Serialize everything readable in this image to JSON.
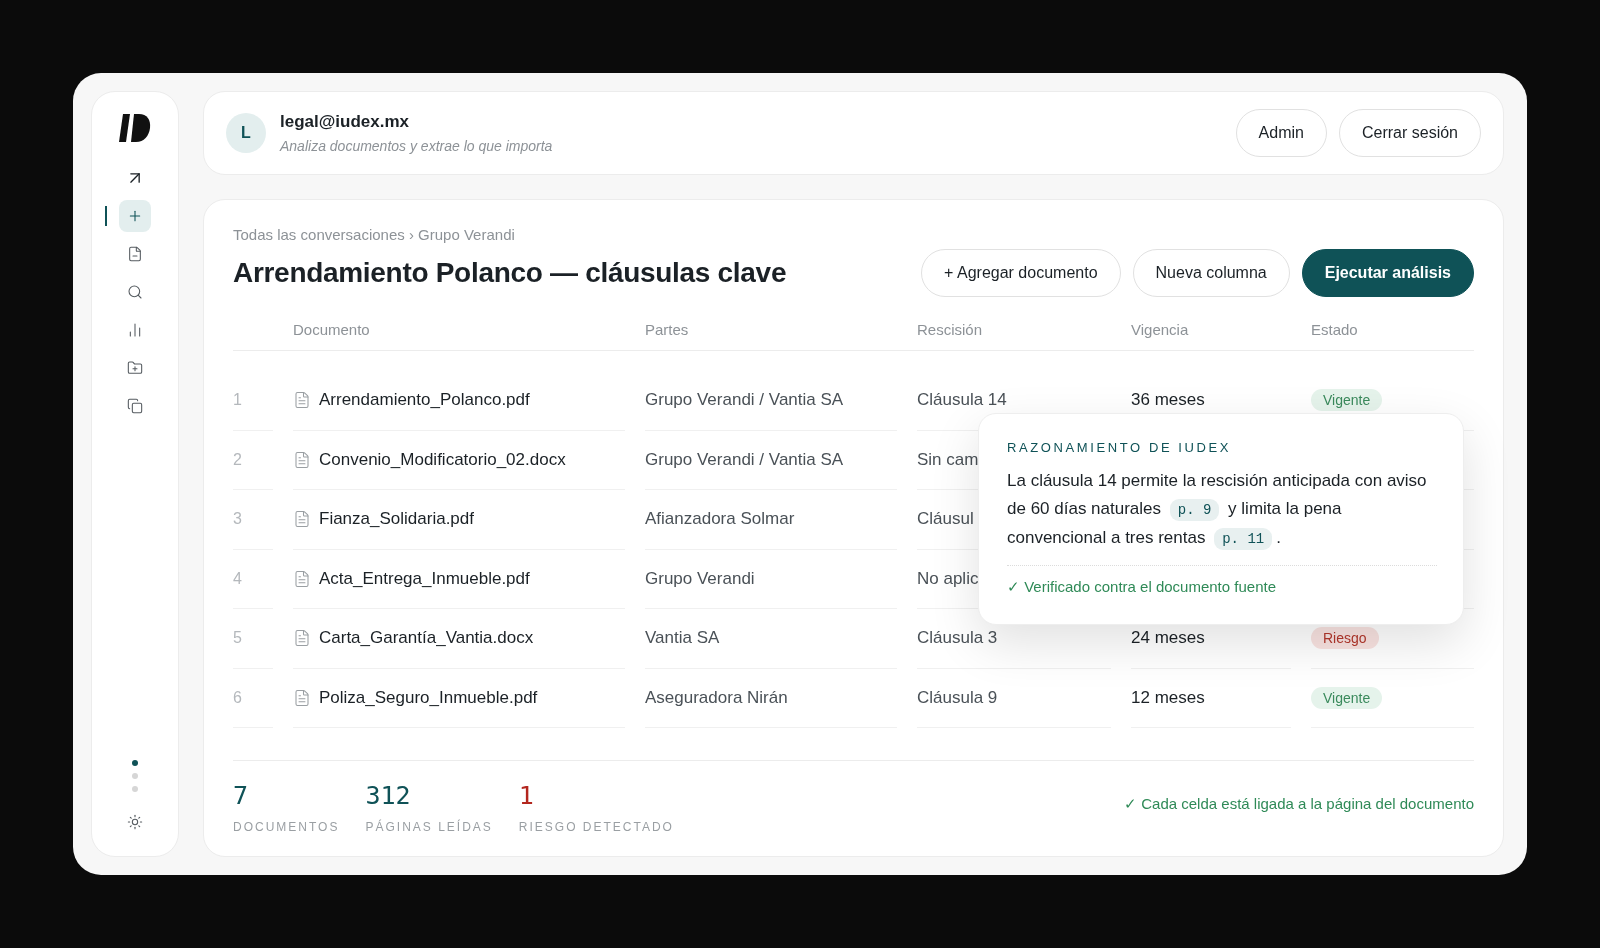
{
  "sidebar": {
    "items": [
      {
        "selected": false
      },
      {
        "selected": true
      },
      {
        "selected": false
      },
      {
        "selected": false
      },
      {
        "selected": false
      },
      {
        "selected": false
      },
      {
        "selected": false
      }
    ],
    "pager": [
      {
        "selected": true
      },
      {
        "selected": false
      },
      {
        "selected": false
      }
    ]
  },
  "header": {
    "avatar": "L",
    "email": "legal@iudex.mx",
    "tagline": "Analiza documentos y extrae lo que importa",
    "buttons": [
      "Admin",
      "Cerrar sesión"
    ]
  },
  "breadcrumb": "Todas las conversaciones › Grupo Verandi",
  "title": "Arrendamiento Polanco — cláusulas clave",
  "actions": [
    {
      "label": "+ Agregar documento",
      "kind": "outline"
    },
    {
      "label": "Nueva columna",
      "kind": "outline"
    },
    {
      "label": "Ejecutar análisis",
      "kind": "primary"
    }
  ],
  "table": {
    "columns": [
      "Documento",
      "Partes",
      "Rescisión",
      "Vigencia",
      "Estado"
    ],
    "rows": [
      {
        "num": "1",
        "document": "Arrendamiento_Polanco.pdf",
        "parties": "Grupo Verandi / Vantia SA",
        "rescission": "Cláusula 14",
        "term": "36 meses",
        "status": {
          "label": "Vigente",
          "kind": "ok"
        }
      },
      {
        "num": "2",
        "document": "Convenio_Modificatorio_02.docx",
        "parties": "Grupo Verandi / Vantia SA",
        "rescission": "Sin cam"
      },
      {
        "num": "3",
        "document": "Fianza_Solidaria.pdf",
        "parties": "Afianzadora Solmar",
        "rescission": "Cláusul"
      },
      {
        "num": "4",
        "document": "Acta_Entrega_Inmueble.pdf",
        "parties": "Grupo Verandi",
        "rescission": "No aplic"
      },
      {
        "num": "5",
        "document": "Carta_Garantía_Vantia.docx",
        "parties": "Vantia SA",
        "rescission": "Cláusula 3",
        "term": "24 meses",
        "status": {
          "label": "Riesgo",
          "kind": "risk"
        }
      },
      {
        "num": "6",
        "document": "Poliza_Seguro_Inmueble.pdf",
        "parties": "Aseguradora Nirán",
        "rescission": "Cláusula 9",
        "term": "12 meses",
        "status": {
          "label": "Vigente",
          "kind": "ok"
        }
      }
    ]
  },
  "popover": {
    "label": "RAZONAMIENTO DE IUDEX",
    "body": [
      {
        "kind": "text",
        "text": "La cláusula 14 permite la rescisión anticipada con aviso de 60 días naturales"
      },
      {
        "kind": "ref",
        "text": "p. 9"
      },
      {
        "kind": "text",
        "text": "y limita la pena convencional a tres rentas"
      },
      {
        "kind": "ref",
        "text": "p. 11"
      },
      {
        "kind": "text",
        "text": "."
      }
    ],
    "verified": "✓ Verificado contra el documento fuente"
  },
  "stats": [
    {
      "value": "7",
      "label": "DOCUMENTOS",
      "kind": "normal"
    },
    {
      "value": "312",
      "label": "PÁGINAS LEÍDAS",
      "kind": "normal"
    },
    {
      "value": "1",
      "label": "RIESGO DETECTADO",
      "kind": "risk"
    }
  ],
  "note": "✓ Cada celda está ligada a la página del documento"
}
